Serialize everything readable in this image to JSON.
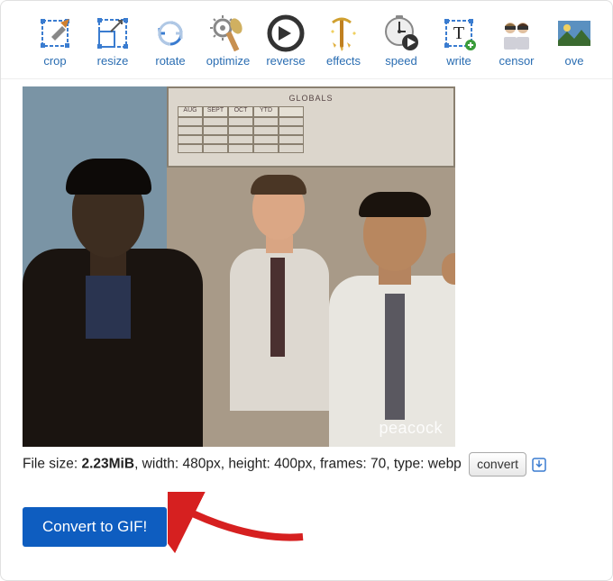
{
  "toolbar": {
    "items": [
      {
        "id": "crop",
        "label": "crop"
      },
      {
        "id": "resize",
        "label": "resize"
      },
      {
        "id": "rotate",
        "label": "rotate"
      },
      {
        "id": "optimize",
        "label": "optimize"
      },
      {
        "id": "reverse",
        "label": "reverse"
      },
      {
        "id": "effects",
        "label": "effects"
      },
      {
        "id": "speed",
        "label": "speed"
      },
      {
        "id": "write",
        "label": "write"
      },
      {
        "id": "censor",
        "label": "censor"
      },
      {
        "id": "overlay",
        "label": "ove"
      }
    ]
  },
  "preview": {
    "watermark": "peacock",
    "board_title": "GLOBALS",
    "board_cols": [
      "AUG",
      "SEPT",
      "OCT",
      "YTD",
      ""
    ]
  },
  "fileinfo": {
    "size_label": "File size: ",
    "size_value": "2.23MiB",
    "width_label": ", width: 480px, height: 400px, frames: 70, type: webp",
    "convert_small": "convert"
  },
  "actions": {
    "convert_to_gif": "Convert to GIF!"
  },
  "colors": {
    "accent": "#0e5dc0",
    "link": "#2a6db2"
  }
}
